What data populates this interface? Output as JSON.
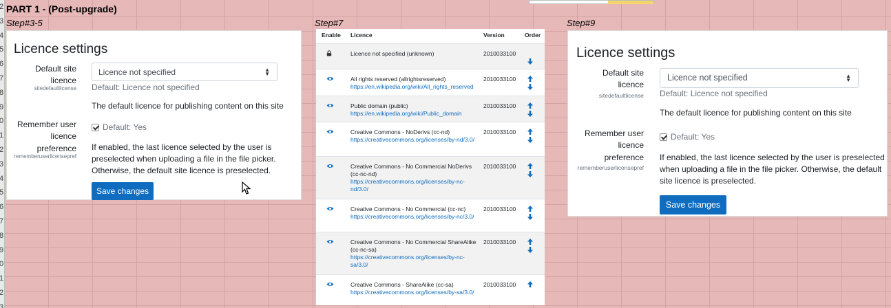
{
  "sheet": {
    "part_title": "PART 1 - (Post-upgrade)",
    "row_numbers": [
      "2",
      "3",
      "4",
      "5",
      "6",
      "7",
      "8",
      "9",
      "0",
      "1",
      "2",
      "3",
      "4",
      "5",
      "6",
      "7",
      "8",
      "9",
      "0",
      "1",
      "2",
      "3"
    ]
  },
  "steps": {
    "step1": "Step#3-5",
    "step2": "Step#7",
    "step3": "Step#9"
  },
  "settings": {
    "heading": "Licence settings",
    "default_licence": {
      "label": "Default site licence",
      "key": "sitedefaultlicense",
      "selected": "Licence not specified",
      "default_text": "Default: Licence not specified",
      "description": "The default licence for publishing content on this site"
    },
    "remember": {
      "label": "Remember user licence preference",
      "key": "rememberuserlicensepref",
      "checkbox_text": "Default: Yes",
      "description": "If enabled, the last licence selected by the user is preselected when uploading a file in the file picker. Otherwise, the default site licence is preselected."
    },
    "save_label": "Save changes"
  },
  "licence_table": {
    "headers": {
      "enable": "Enable",
      "licence": "Licence",
      "version": "Version",
      "order": "Order"
    },
    "rows": [
      {
        "name": "Licence not specified (unknown)",
        "url": "",
        "version": "2010033100",
        "icon": "lock-icon",
        "up": false,
        "down": true
      },
      {
        "name": "All rights reserved (allrightsreserved)",
        "url": "https://en.wikipedia.org/wiki/All_rights_reserved",
        "version": "2010033100",
        "icon": "eye-icon",
        "up": true,
        "down": true
      },
      {
        "name": "Public domain (public)",
        "url": "https://en.wikipedia.org/wiki/Public_domain",
        "version": "2010033100",
        "icon": "eye-icon",
        "up": true,
        "down": true
      },
      {
        "name": "Creative Commons - NoDerivs (cc-nd)",
        "url": "https://creativecommons.org/licenses/by-nd/3.0/",
        "version": "2010033100",
        "icon": "eye-icon",
        "up": true,
        "down": true
      },
      {
        "name": "Creative Commons - No Commercial NoDerivs (cc-nc-nd)",
        "url": "https://creativecommons.org/licenses/by-nc-nd/3.0/",
        "version": "2010033100",
        "icon": "eye-icon",
        "up": true,
        "down": true
      },
      {
        "name": "Creative Commons - No Commercial (cc-nc)",
        "url": "https://creativecommons.org/licenses/by-nc/3.0/",
        "version": "2010033100",
        "icon": "eye-icon",
        "up": true,
        "down": true
      },
      {
        "name": "Creative Commons - No Commercial ShareAlike (cc-nc-sa)",
        "url": "https://creativecommons.org/licenses/by-nc-sa/3.0/",
        "version": "2010033100",
        "icon": "eye-icon",
        "up": true,
        "down": true
      },
      {
        "name": "Creative Commons - ShareAlike (cc-sa)",
        "url": "https://creativecommons.org/licenses/by-sa/3.0/",
        "version": "2010033100",
        "icon": "eye-icon",
        "up": true,
        "down": false
      }
    ]
  },
  "colors": {
    "primary": "#0f6cbf",
    "sheet_bg": "#e6b8b8",
    "muted": "#6a737b"
  }
}
